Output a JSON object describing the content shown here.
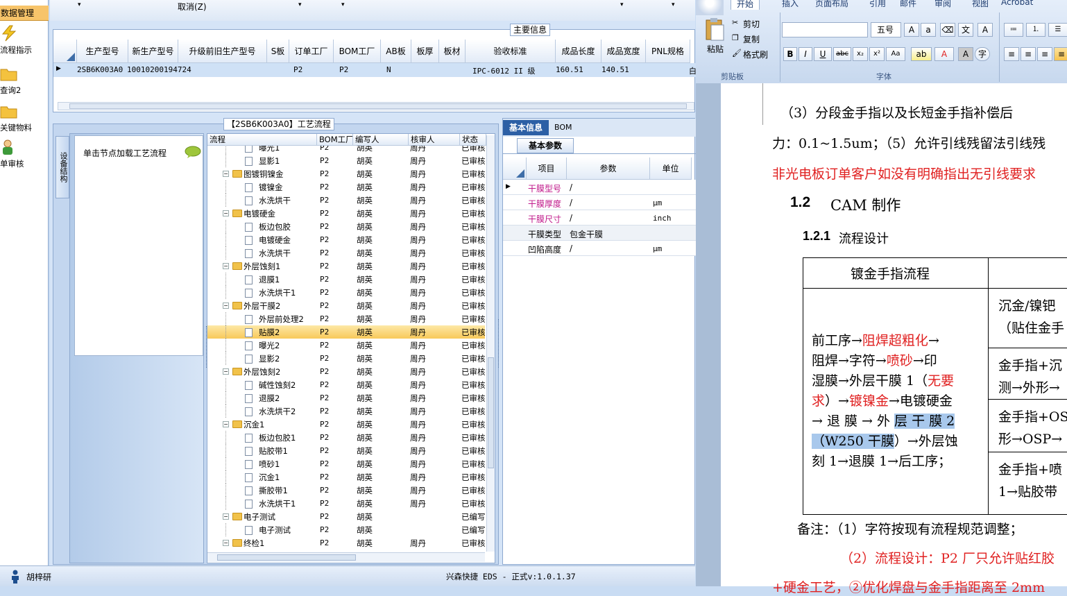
{
  "left_nav": {
    "header": "数据管理",
    "items": [
      {
        "label": "流程指示"
      },
      {
        "label": "查询2"
      },
      {
        "label": "关键物料"
      },
      {
        "label": "单审核"
      }
    ]
  },
  "toolbar": {
    "cancel_label": "取消(Z)"
  },
  "main_info": {
    "caption": "主要信息",
    "columns": [
      "生产型号",
      "新生产型号",
      "升级前旧生产型号",
      "S板",
      "订单工厂",
      "BOM工厂",
      "AB板",
      "板厚",
      "板材",
      "验收标准",
      "成品长度",
      "成品宽度",
      "PNL规格"
    ],
    "row": {
      "prod_model": "2SB6K003A0",
      "new_model": "10010200194724",
      "order_factory": "P2",
      "bom_factory": "P2",
      "ab": "N",
      "standard": "IPC-6012 II 级",
      "length": "160.51",
      "width": "140.51",
      "pnl": "白"
    }
  },
  "process": {
    "caption": "【2SB6K003A0】工艺流程",
    "side_tab": "设备结构",
    "hint": "单击节点加载工艺流程",
    "columns": [
      "流程",
      "BOM工厂",
      "编写人",
      "核审人",
      "状态"
    ],
    "rows": [
      {
        "name": "曝光1",
        "lvl": 2,
        "bom": "P2",
        "writer": "胡英",
        "reviewer": "周丹",
        "status": "已审核"
      },
      {
        "name": "显影1",
        "lvl": 2,
        "bom": "P2",
        "writer": "胡英",
        "reviewer": "周丹",
        "status": "已审核"
      },
      {
        "name": "图镀铜镍金",
        "lvl": 1,
        "bom": "P2",
        "writer": "胡英",
        "reviewer": "周丹",
        "status": "已审核"
      },
      {
        "name": "镀镍金",
        "lvl": 2,
        "bom": "P2",
        "writer": "胡英",
        "reviewer": "周丹",
        "status": "已审核"
      },
      {
        "name": "水洗烘干",
        "lvl": 2,
        "bom": "P2",
        "writer": "胡英",
        "reviewer": "周丹",
        "status": "已审核"
      },
      {
        "name": "电镀硬金",
        "lvl": 1,
        "bom": "P2",
        "writer": "胡英",
        "reviewer": "周丹",
        "status": "已审核"
      },
      {
        "name": "板边包胶",
        "lvl": 2,
        "bom": "P2",
        "writer": "胡英",
        "reviewer": "周丹",
        "status": "已审核"
      },
      {
        "name": "电镀硬金",
        "lvl": 2,
        "bom": "P2",
        "writer": "胡英",
        "reviewer": "周丹",
        "status": "已审核"
      },
      {
        "name": "水洗烘干",
        "lvl": 2,
        "bom": "P2",
        "writer": "胡英",
        "reviewer": "周丹",
        "status": "已审核"
      },
      {
        "name": "外层蚀刻1",
        "lvl": 1,
        "bom": "P2",
        "writer": "胡英",
        "reviewer": "周丹",
        "status": "已审核"
      },
      {
        "name": "退膜1",
        "lvl": 2,
        "bom": "P2",
        "writer": "胡英",
        "reviewer": "周丹",
        "status": "已审核"
      },
      {
        "name": "水洗烘干1",
        "lvl": 2,
        "bom": "P2",
        "writer": "胡英",
        "reviewer": "周丹",
        "status": "已审核"
      },
      {
        "name": "外层干膜2",
        "lvl": 1,
        "bom": "P2",
        "writer": "胡英",
        "reviewer": "周丹",
        "status": "已审核"
      },
      {
        "name": "外层前处理2",
        "lvl": 2,
        "bom": "P2",
        "writer": "胡英",
        "reviewer": "周丹",
        "status": "已审核"
      },
      {
        "name": "贴膜2",
        "lvl": 2,
        "bom": "P2",
        "writer": "胡英",
        "reviewer": "周丹",
        "status": "已审核",
        "selected": true
      },
      {
        "name": "曝光2",
        "lvl": 2,
        "bom": "P2",
        "writer": "胡英",
        "reviewer": "周丹",
        "status": "已审核"
      },
      {
        "name": "显影2",
        "lvl": 2,
        "bom": "P2",
        "writer": "胡英",
        "reviewer": "周丹",
        "status": "已审核"
      },
      {
        "name": "外层蚀刻2",
        "lvl": 1,
        "bom": "P2",
        "writer": "胡英",
        "reviewer": "周丹",
        "status": "已审核"
      },
      {
        "name": "碱性蚀刻2",
        "lvl": 2,
        "bom": "P2",
        "writer": "胡英",
        "reviewer": "周丹",
        "status": "已审核"
      },
      {
        "name": "退膜2",
        "lvl": 2,
        "bom": "P2",
        "writer": "胡英",
        "reviewer": "周丹",
        "status": "已审核"
      },
      {
        "name": "水洗烘干2",
        "lvl": 2,
        "bom": "P2",
        "writer": "胡英",
        "reviewer": "周丹",
        "status": "已审核"
      },
      {
        "name": "沉金1",
        "lvl": 1,
        "bom": "P2",
        "writer": "胡英",
        "reviewer": "周丹",
        "status": "已审核"
      },
      {
        "name": "板边包胶1",
        "lvl": 2,
        "bom": "P2",
        "writer": "胡英",
        "reviewer": "周丹",
        "status": "已审核"
      },
      {
        "name": "贴胶带1",
        "lvl": 2,
        "bom": "P2",
        "writer": "胡英",
        "reviewer": "周丹",
        "status": "已审核"
      },
      {
        "name": "喷砂1",
        "lvl": 2,
        "bom": "P2",
        "writer": "胡英",
        "reviewer": "周丹",
        "status": "已审核"
      },
      {
        "name": "沉金1",
        "lvl": 2,
        "bom": "P2",
        "writer": "胡英",
        "reviewer": "周丹",
        "status": "已审核"
      },
      {
        "name": "撕胶带1",
        "lvl": 2,
        "bom": "P2",
        "writer": "胡英",
        "reviewer": "周丹",
        "status": "已审核"
      },
      {
        "name": "水洗烘干1",
        "lvl": 2,
        "bom": "P2",
        "writer": "胡英",
        "reviewer": "周丹",
        "status": "已审核"
      },
      {
        "name": "电子测试",
        "lvl": 1,
        "bom": "P2",
        "writer": "胡英",
        "reviewer": "",
        "status": "已编写"
      },
      {
        "name": "电子测试",
        "lvl": 2,
        "bom": "P2",
        "writer": "胡英",
        "reviewer": "",
        "status": "已编写"
      },
      {
        "name": "终检1",
        "lvl": 1,
        "bom": "P2",
        "writer": "胡英",
        "reviewer": "周丹",
        "status": "已审核"
      }
    ]
  },
  "basic": {
    "tabs": [
      "基本信息",
      "BOM"
    ],
    "subtab": "基本参数",
    "columns": [
      "项目",
      "参数",
      "单位"
    ],
    "rows": [
      {
        "item": "干膜型号",
        "param": "/",
        "unit": "",
        "highlight": true
      },
      {
        "item": "干膜厚度",
        "param": "/",
        "unit": "μm",
        "highlight": true
      },
      {
        "item": "干膜尺寸",
        "param": "/",
        "unit": "inch",
        "highlight": true
      },
      {
        "item": "干膜类型",
        "param": "包金干膜",
        "unit": "",
        "highlight": false
      },
      {
        "item": "凹陷高度",
        "param": "/",
        "unit": "μm",
        "highlight": false
      }
    ]
  },
  "status_bar": {
    "user": "胡梓研",
    "app": "兴森快捷 EDS - 正式v:1.0.1.37"
  },
  "word": {
    "tabs": [
      "开始",
      "插入",
      "页面布局",
      "引用",
      "邮件",
      "审阅",
      "视图",
      "Acrobat"
    ],
    "clipboard": {
      "paste": "粘贴",
      "cut": "剪切",
      "copy": "复制",
      "format": "格式刷",
      "group": "剪贴板"
    },
    "font": {
      "size": "五号",
      "group": "字体"
    },
    "doc": {
      "line1": "（3）分段金手指以及长短金手指补偿后",
      "line2": "力：0.1~1.5um；（5）允许引线残留法引线残",
      "line3": "非光电板订单客户如没有明确指出无引线要求",
      "h1_num": "1.2",
      "h1": "CAM 制作",
      "h2_num": "1.2.1",
      "h2": "流程设计",
      "table_head": "镀金手指流程",
      "cell_lines": [
        [
          {
            "t": "前工序→"
          },
          {
            "t": "阻焊超粗化",
            "c": "red"
          },
          {
            "t": "→"
          }
        ],
        [
          {
            "t": "阻焊→字符→"
          },
          {
            "t": "喷砂",
            "c": "red"
          },
          {
            "t": "→印"
          }
        ],
        [
          {
            "t": "湿膜→外层干膜 1（"
          },
          {
            "t": "无要",
            "c": "red"
          }
        ],
        [
          {
            "t": "求",
            "c": "red"
          },
          {
            "t": "）→"
          },
          {
            "t": "镀镍金",
            "c": "red"
          },
          {
            "t": "→电镀硬金"
          }
        ],
        [
          {
            "t": "→ 退 膜 → 外 "
          },
          {
            "t": "层 干 膜  2",
            "c": "hl"
          }
        ],
        [
          {
            "t": "（W250 干膜",
            "c": "hl"
          },
          {
            "t": "）→外层蚀"
          }
        ],
        [
          {
            "t": "刻 1→退膜 1→后工序；"
          }
        ]
      ],
      "right_cells": [
        {
          "l1": "沉金/镍钯",
          "l2": "（贴住金手"
        },
        {
          "l1": "金手指+沉",
          "l2": "测→外形→"
        },
        {
          "l1": "金手指+OS",
          "l2": "形→OSP→"
        },
        {
          "l1": "金手指+喷",
          "l2": "1→贴胶带"
        }
      ],
      "note1": "备注：（1）字符按现有流程规范调整；",
      "note2": "（2）流程设计：P2 厂只允许贴红胶",
      "note3": "+硬金工艺，②优化焊盘与金手指距离至 2mm"
    }
  }
}
